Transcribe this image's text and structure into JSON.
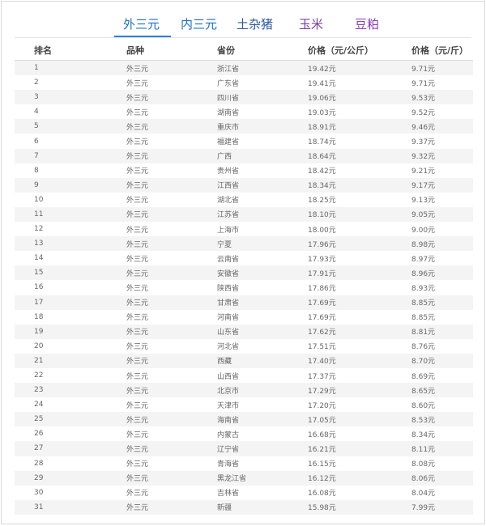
{
  "tabs": [
    {
      "label": "外三元",
      "active": true
    },
    {
      "label": "内三元",
      "active": false
    },
    {
      "label": "土杂猪",
      "active": false
    },
    {
      "label": "玉米",
      "active": false
    },
    {
      "label": "豆粕",
      "active": false
    }
  ],
  "colors": {
    "tab_active": "#1f6fc5",
    "tab_inactive_1": "#1f6fc5",
    "tab_inactive_2": "#2c5aa0",
    "tab_inactive_3": "#7b3fa0",
    "tab_inactive_4": "#8a3cb8",
    "row_alt_bg": "#f4f4f4"
  },
  "table": {
    "headers": [
      "排名",
      "品种",
      "省份",
      "价格（元/公斤）",
      "价格（元/斤）"
    ],
    "rows": [
      [
        "1",
        "外三元",
        "浙江省",
        "19.42元",
        "9.71元"
      ],
      [
        "2",
        "外三元",
        "广东省",
        "19.41元",
        "9.71元"
      ],
      [
        "3",
        "外三元",
        "四川省",
        "19.06元",
        "9.53元"
      ],
      [
        "4",
        "外三元",
        "湖南省",
        "19.03元",
        "9.52元"
      ],
      [
        "5",
        "外三元",
        "重庆市",
        "18.91元",
        "9.46元"
      ],
      [
        "6",
        "外三元",
        "福建省",
        "18.74元",
        "9.37元"
      ],
      [
        "7",
        "外三元",
        "广西",
        "18.64元",
        "9.32元"
      ],
      [
        "8",
        "外三元",
        "贵州省",
        "18.42元",
        "9.21元"
      ],
      [
        "9",
        "外三元",
        "江西省",
        "18.34元",
        "9.17元"
      ],
      [
        "10",
        "外三元",
        "湖北省",
        "18.25元",
        "9.13元"
      ],
      [
        "11",
        "外三元",
        "江苏省",
        "18.10元",
        "9.05元"
      ],
      [
        "12",
        "外三元",
        "上海市",
        "18.00元",
        "9.00元"
      ],
      [
        "13",
        "外三元",
        "宁夏",
        "17.96元",
        "8.98元"
      ],
      [
        "14",
        "外三元",
        "云南省",
        "17.93元",
        "8.97元"
      ],
      [
        "15",
        "外三元",
        "安徽省",
        "17.91元",
        "8.96元"
      ],
      [
        "16",
        "外三元",
        "陕西省",
        "17.86元",
        "8.93元"
      ],
      [
        "17",
        "外三元",
        "甘肃省",
        "17.69元",
        "8.85元"
      ],
      [
        "18",
        "外三元",
        "河南省",
        "17.69元",
        "8.85元"
      ],
      [
        "19",
        "外三元",
        "山东省",
        "17.62元",
        "8.81元"
      ],
      [
        "20",
        "外三元",
        "河北省",
        "17.51元",
        "8.76元"
      ],
      [
        "21",
        "外三元",
        "西藏",
        "17.40元",
        "8.70元"
      ],
      [
        "22",
        "外三元",
        "山西省",
        "17.37元",
        "8.69元"
      ],
      [
        "23",
        "外三元",
        "北京市",
        "17.29元",
        "8.65元"
      ],
      [
        "24",
        "外三元",
        "天津市",
        "17.20元",
        "8.60元"
      ],
      [
        "25",
        "外三元",
        "海南省",
        "17.05元",
        "8.53元"
      ],
      [
        "26",
        "外三元",
        "内蒙古",
        "16.68元",
        "8.34元"
      ],
      [
        "27",
        "外三元",
        "辽宁省",
        "16.21元",
        "8.11元"
      ],
      [
        "28",
        "外三元",
        "青海省",
        "16.15元",
        "8.08元"
      ],
      [
        "29",
        "外三元",
        "黑龙江省",
        "16.12元",
        "8.06元"
      ],
      [
        "30",
        "外三元",
        "吉林省",
        "16.08元",
        "8.04元"
      ],
      [
        "31",
        "外三元",
        "新疆",
        "15.98元",
        "7.99元"
      ]
    ]
  }
}
